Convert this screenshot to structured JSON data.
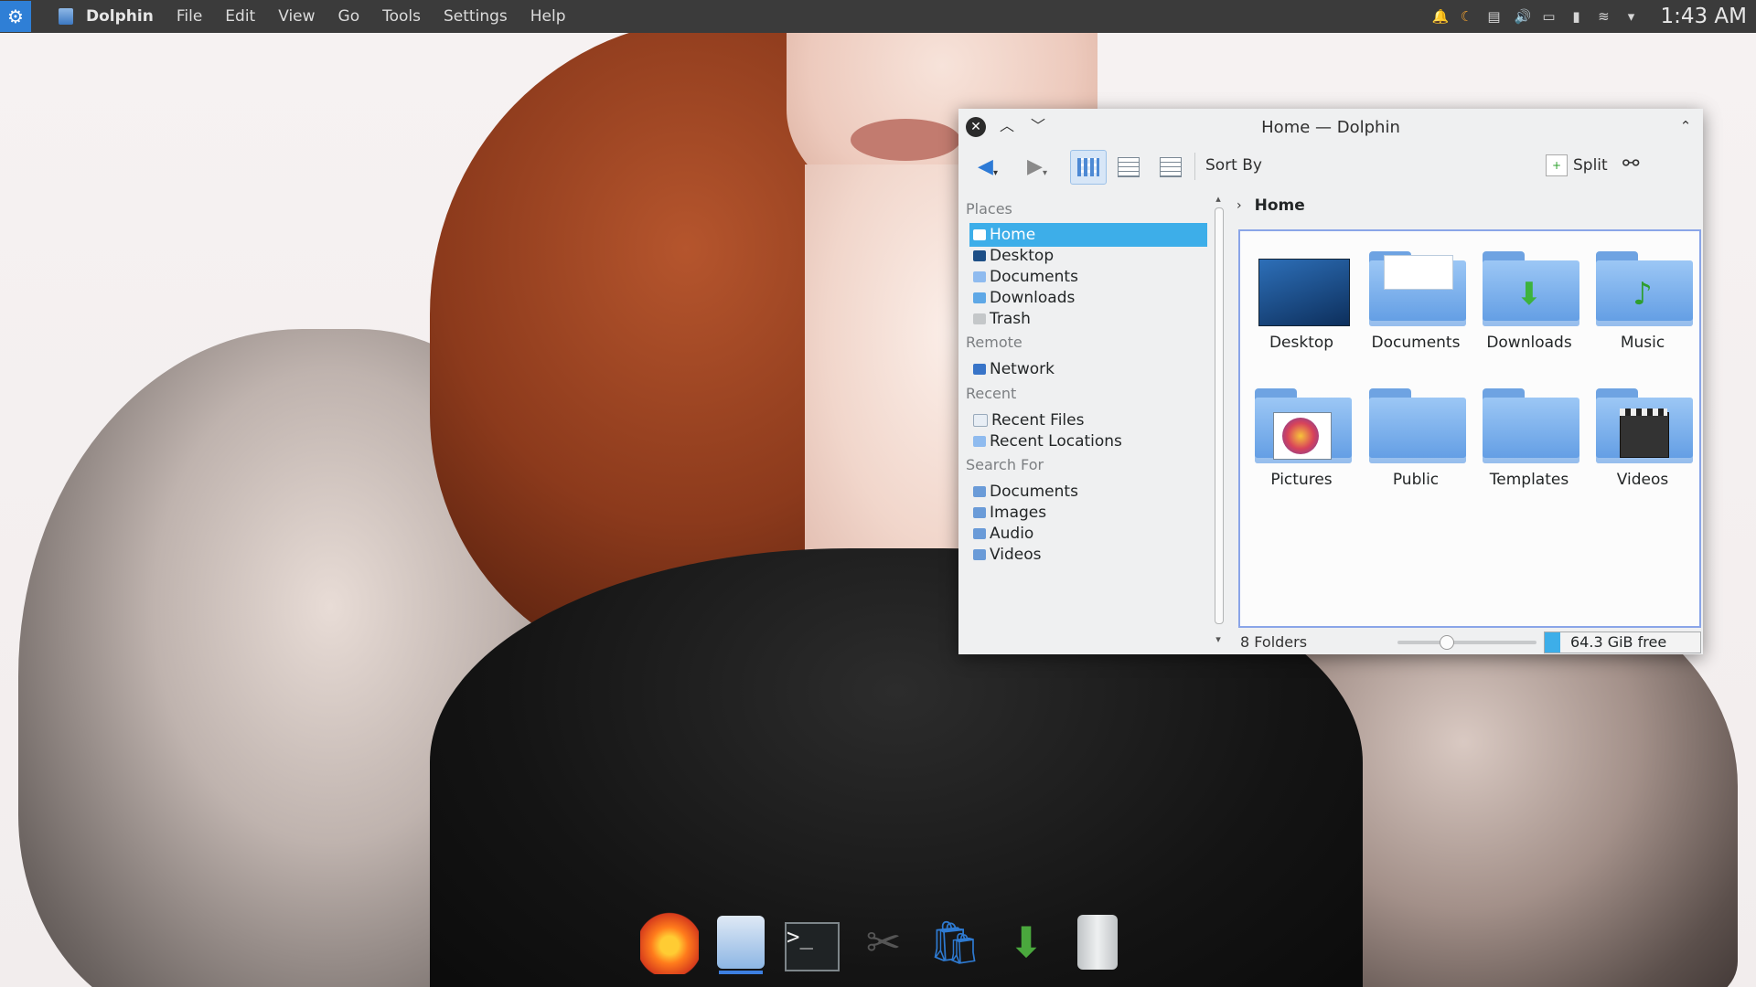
{
  "top_panel": {
    "app_name": "Dolphin",
    "menus": [
      "File",
      "Edit",
      "View",
      "Go",
      "Tools",
      "Settings",
      "Help"
    ],
    "tray_icons": [
      "notifications-icon",
      "night-color-icon",
      "clipboard-icon",
      "volume-icon",
      "battery-icon",
      "usb-icon",
      "wifi-icon",
      "expand-tray-icon"
    ],
    "clock": "1:43 AM"
  },
  "window": {
    "title": "Home — Dolphin",
    "toolbar": {
      "sort_by": "Sort By",
      "split": "Split"
    },
    "places": {
      "sections": [
        {
          "title": "Places",
          "items": [
            "Home",
            "Desktop",
            "Documents",
            "Downloads",
            "Trash"
          ]
        },
        {
          "title": "Remote",
          "items": [
            "Network"
          ]
        },
        {
          "title": "Recent",
          "items": [
            "Recent Files",
            "Recent Locations"
          ]
        },
        {
          "title": "Search For",
          "items": [
            "Documents",
            "Images",
            "Audio",
            "Videos"
          ]
        }
      ],
      "active": "Home"
    },
    "breadcrumb": "Home",
    "files": [
      "Desktop",
      "Documents",
      "Downloads",
      "Music",
      "Pictures",
      "Public",
      "Templates",
      "Videos"
    ],
    "status": {
      "text": "8 Folders",
      "zoom_level": 0.35,
      "free_space": "64.3 GiB free",
      "free_fraction": 0.1
    }
  },
  "colors": {
    "accent": "#3daee9",
    "panel": "#3b3b3b"
  },
  "dock": [
    "firefox-icon",
    "file-manager-icon",
    "terminal-icon",
    "system-settings-icon",
    "discover-store-icon",
    "downloads-folder-icon",
    "trash-icon"
  ]
}
